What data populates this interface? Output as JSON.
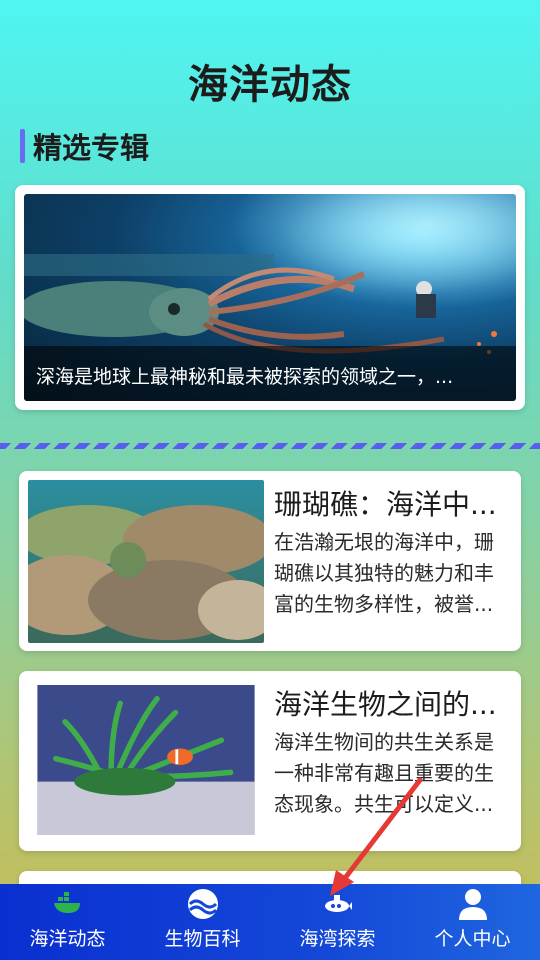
{
  "page": {
    "title": "海洋动态"
  },
  "section": {
    "title": "精选专辑"
  },
  "featured": {
    "caption": "深海是地球上最神秘和最未被探索的领域之一，..."
  },
  "articles": [
    {
      "title": "珊瑚礁：海洋中...",
      "desc": "在浩瀚无垠的海洋中，珊瑚礁以其独特的魅力和丰富的生物多样性，被誉..."
    },
    {
      "title": "海洋生物之间的...",
      "desc": "海洋生物间的共生关系是一种非常有趣且重要的生态现象。共生可以定义..."
    }
  ],
  "tabbar": {
    "items": [
      {
        "label": "海洋动态",
        "icon": "whale-icon"
      },
      {
        "label": "生物百科",
        "icon": "wave-icon"
      },
      {
        "label": "海湾探索",
        "icon": "submarine-icon"
      },
      {
        "label": "个人中心",
        "icon": "person-icon"
      }
    ]
  },
  "colors": {
    "accent": "#6a6cf0",
    "tabbar": "#1448d8",
    "arrow": "#e53935"
  }
}
